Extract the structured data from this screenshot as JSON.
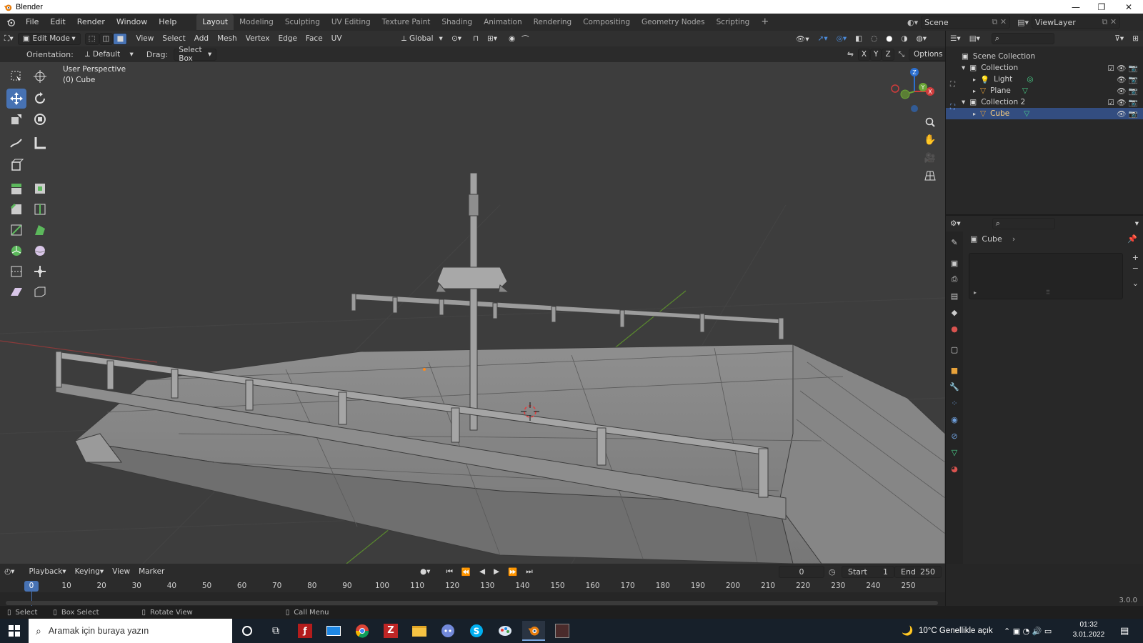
{
  "window": {
    "title": "Blender",
    "minimize": "—",
    "restore": "❐",
    "close": "✕"
  },
  "menu": [
    "File",
    "Edit",
    "Render",
    "Window",
    "Help"
  ],
  "workspaces": [
    "Layout",
    "Modeling",
    "Sculpting",
    "UV Editing",
    "Texture Paint",
    "Shading",
    "Animation",
    "Rendering",
    "Compositing",
    "Geometry Nodes",
    "Scripting"
  ],
  "active_workspace": "Layout",
  "scene": {
    "name": "Scene",
    "view_layer": "ViewLayer"
  },
  "viewport_header": {
    "mode": "Edit Mode",
    "menus": [
      "View",
      "Select",
      "Add",
      "Mesh",
      "Vertex",
      "Edge",
      "Face",
      "UV"
    ],
    "transform_orientation": "Global"
  },
  "tool_settings": {
    "orientation_label": "Orientation:",
    "orientation_value": "Default",
    "drag_label": "Drag:",
    "drag_value": "Select Box",
    "axes": [
      "X",
      "Y",
      "Z"
    ],
    "options": "Options"
  },
  "viewport": {
    "view_name": "User Perspective",
    "object_info": "(0) Cube"
  },
  "gizmo": {
    "x": "X",
    "y": "Y",
    "z": "Z"
  },
  "outliner": {
    "root": "Scene Collection",
    "items": [
      {
        "label": "Collection",
        "type": "collection"
      },
      {
        "label": "Light",
        "type": "light"
      },
      {
        "label": "Plane",
        "type": "mesh"
      },
      {
        "label": "Collection 2",
        "type": "collection"
      },
      {
        "label": "Cube",
        "type": "mesh"
      }
    ]
  },
  "properties": {
    "object_name": "Cube"
  },
  "timeline": {
    "menus": [
      "Playback",
      "Keying",
      "View",
      "Marker"
    ],
    "current_frame": "0",
    "start_label": "Start",
    "start": "1",
    "end_label": "End",
    "end": "250",
    "ticks": [
      "0",
      "10",
      "20",
      "30",
      "40",
      "50",
      "60",
      "70",
      "80",
      "90",
      "100",
      "110",
      "120",
      "130",
      "140",
      "150",
      "160",
      "170",
      "180",
      "190",
      "200",
      "210",
      "220",
      "230",
      "240",
      "250"
    ]
  },
  "statusbar": {
    "select": "Select",
    "box_select": "Box Select",
    "rotate": "Rotate View",
    "call_menu": "Call Menu",
    "version": "3.0.0"
  },
  "taskbar": {
    "search_placeholder": "Aramak için buraya yazın",
    "weather": "10°C  Genellikle açık",
    "time": "01:32",
    "date": "3.01.2022"
  },
  "colors": {
    "accent": "#4772b3",
    "selection": "#334d80",
    "viewport_bg": "#3d3d3d",
    "mesh": "#8d8d8d",
    "active_tab": "#3d3d3d"
  }
}
